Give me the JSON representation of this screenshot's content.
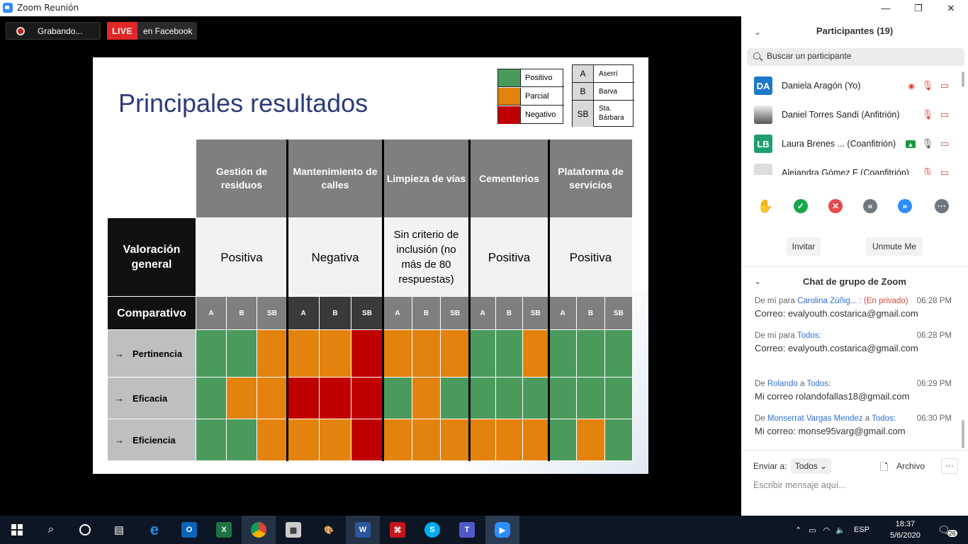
{
  "window": {
    "title": "Zoom Reunión",
    "minimize": "—",
    "restore": "❐",
    "close": "✕"
  },
  "recording": {
    "label": "Grabando..."
  },
  "live": {
    "badge": "LIVE",
    "platform": "en Facebook"
  },
  "slide": {
    "title": "Principales resultados",
    "legend": [
      {
        "label": "Positivo",
        "color": "#4a9a5c"
      },
      {
        "label": "Parcial",
        "color": "#e4820e"
      },
      {
        "label": "Negativo",
        "color": "#c00000"
      }
    ],
    "place_legend": [
      {
        "key": "A",
        "label": "Aserrí"
      },
      {
        "key": "B",
        "label": "Barva"
      },
      {
        "key": "SB",
        "label": "Sta. Bárbara"
      }
    ],
    "services": [
      "Gestión de residuos",
      "Mantenimiento de calles",
      "Limpieza de vías",
      "Cementerios",
      "Plataforma de servicios"
    ],
    "valoracion_label": "Valoración general",
    "valoraciones": [
      "Positiva",
      "Negativa",
      "Sin criterio de inclusión (no más de 80 respuestas)",
      "Positiva",
      "Positiva"
    ],
    "comparativo_label": "Comparativo",
    "sub_labels": [
      "A",
      "B",
      "SB"
    ],
    "rows": [
      {
        "label": "Pertinencia",
        "arrow": "→",
        "cells": [
          "G",
          "G",
          "O",
          "O",
          "O",
          "R",
          "O",
          "O",
          "O",
          "G",
          "G",
          "O",
          "G",
          "G",
          "G"
        ]
      },
      {
        "label": "Eficacia",
        "arrow": "→",
        "cells": [
          "G",
          "O",
          "O",
          "R",
          "R",
          "R",
          "G",
          "O",
          "G",
          "G",
          "G",
          "G",
          "G",
          "G",
          "G"
        ]
      },
      {
        "label": "Eficiencia",
        "arrow": "→",
        "cells": [
          "G",
          "G",
          "O",
          "O",
          "O",
          "R",
          "O",
          "O",
          "O",
          "O",
          "O",
          "O",
          "G",
          "O",
          "G"
        ]
      }
    ],
    "colors": {
      "G": "#4a9a5c",
      "O": "#e4820e",
      "R": "#c00000"
    }
  },
  "participants": {
    "header": "Participantes (19)",
    "search_placeholder": "Buscar un participante",
    "list": [
      {
        "initials": "DA",
        "name": "Daniela Aragón (Yo)",
        "avatar_color": "#1f78c8"
      },
      {
        "initials": "",
        "name": "Daniel Torres Sandi (Anfitrión)",
        "avatar_color": "#888888"
      },
      {
        "initials": "LB",
        "name": "Laura Brenes ...    (Coanfitrión)",
        "avatar_color": "#1f9e6e"
      },
      {
        "initials": "",
        "name": "Alejandra Gómez F (Coanfitrión)",
        "avatar_color": "#cccccc"
      }
    ],
    "invite": "Invitar",
    "unmute": "Unmute Me"
  },
  "chat": {
    "header": "Chat de grupo de Zoom",
    "messages": [
      {
        "prefix": "De mí para ",
        "to": "Carolina Zúñig... :",
        "tag": " (En privado)",
        "time": "06:28 PM",
        "text": "Correo: evalyouth.costarica@gmail.com"
      },
      {
        "prefix": "De mí para ",
        "to": "Todos:",
        "tag": "",
        "time": "06:28 PM",
        "text": "Correo: evalyouth.costarica@gmail.com"
      },
      {
        "prefix": "De ",
        "from": "Rolando",
        "mid": " a ",
        "to": "Todos:",
        "time": "06:29 PM",
        "text": "Mi correo rolandofallas18@gmail.com"
      },
      {
        "prefix": "De ",
        "from": "Monserrat Vargas Mendez",
        "mid": " a ",
        "to": "Todos:",
        "time": "06:30 PM",
        "text": "Mi correo: monse95varg@gmail.com"
      }
    ],
    "send_to_label": "Enviar a:",
    "send_to_value": "Todos",
    "file_label": "Archivo",
    "more": "···",
    "compose_placeholder": "Escribir mensaje aquí..."
  },
  "taskbar": {
    "language": "ESP",
    "time": "18:37",
    "date": "5/6/2020",
    "notifications": "26"
  }
}
